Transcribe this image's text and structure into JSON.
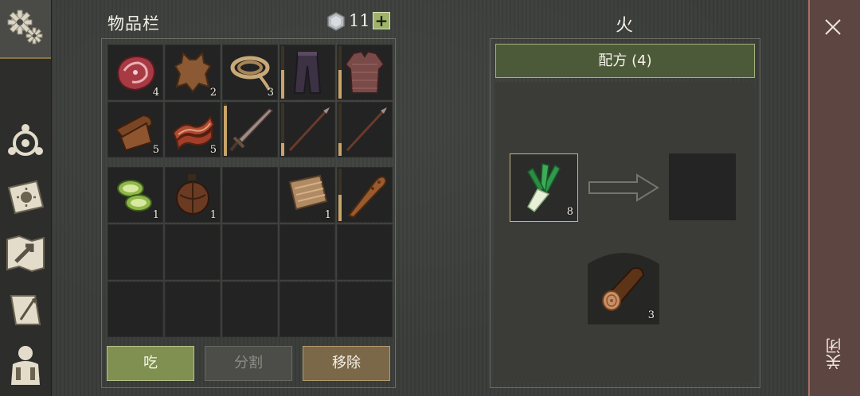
{
  "inventory": {
    "title": "物品栏",
    "currency": {
      "icon": "hex-gem-icon",
      "count": "11"
    },
    "add_label": "+",
    "grid_top": [
      {
        "item": "raw-meat-icon",
        "count": "4"
      },
      {
        "item": "leather-hide-icon",
        "count": "2"
      },
      {
        "item": "rope-icon",
        "count": "3"
      },
      {
        "item": "pants-icon",
        "durability": 0.55
      },
      {
        "item": "chainmail-icon",
        "durability": 0.55
      },
      {
        "item": "leather-roll-icon",
        "count": "5"
      },
      {
        "item": "bacon-strips-icon",
        "count": "5"
      },
      {
        "item": "sword-icon",
        "durability": 0.95
      },
      {
        "item": "spear-icon",
        "durability": 0.25
      },
      {
        "item": "spear-icon",
        "durability": 0.25
      }
    ],
    "grid_bottom": [
      {
        "item": "cucumber-slices-icon",
        "count": "1"
      },
      {
        "item": "water-flask-icon",
        "count": "1"
      },
      {
        "item": ""
      },
      {
        "item": "cloth-icon",
        "count": "1"
      },
      {
        "item": "wooden-club-icon",
        "durability": 0.5
      },
      {
        "item": ""
      },
      {
        "item": ""
      },
      {
        "item": ""
      },
      {
        "item": ""
      },
      {
        "item": ""
      },
      {
        "item": ""
      },
      {
        "item": ""
      },
      {
        "item": ""
      },
      {
        "item": ""
      },
      {
        "item": ""
      }
    ],
    "buttons": {
      "eat": "吃",
      "split": "分割",
      "remove": "移除"
    }
  },
  "fire": {
    "title": "火",
    "recipes_label": "配方 (4)",
    "ingredient": {
      "icon": "leek-icon",
      "count": "8"
    },
    "arrow_icon": "arrow-right-icon",
    "result_icon": "",
    "fuel": {
      "icon": "log-icon",
      "count": "3"
    }
  },
  "sidebar": {
    "items": [
      "settings-gear-icon",
      "crafting-icon",
      "skills-book-icon",
      "map-icon",
      "quest-scroll-icon",
      "character-icon"
    ]
  },
  "close": {
    "label": "关闭",
    "icon": "close-icon"
  },
  "colors": {
    "accent_green": "#7f9050",
    "accent_brown": "#7a6849",
    "close_red": "#5d4541"
  }
}
